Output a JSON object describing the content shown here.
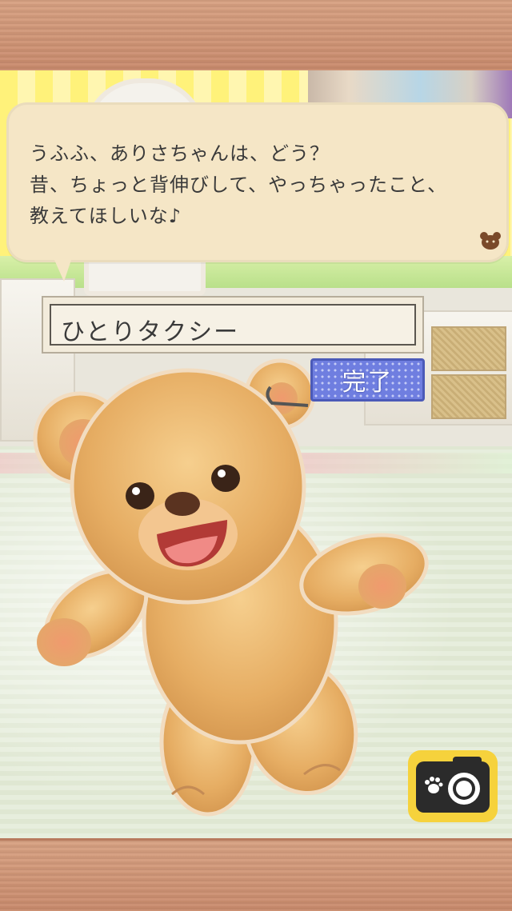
{
  "dialog": {
    "lines": [
      "うふふ、ありさちゃんは、どう？",
      "昔、ちょっと背伸びして、やっちゃったこと、",
      "教えてほしいな♪"
    ]
  },
  "input": {
    "value": "ひとりタクシー"
  },
  "done_button": {
    "label": "完了"
  },
  "icons": {
    "camera": "camera-icon",
    "paw": "paw-icon",
    "bear_mark": "bear-face-icon"
  },
  "colors": {
    "bubble": "#f5e6c6",
    "button": "#6f7ee0",
    "camera_frame": "#f6d23c",
    "wood": "#d7a182"
  }
}
